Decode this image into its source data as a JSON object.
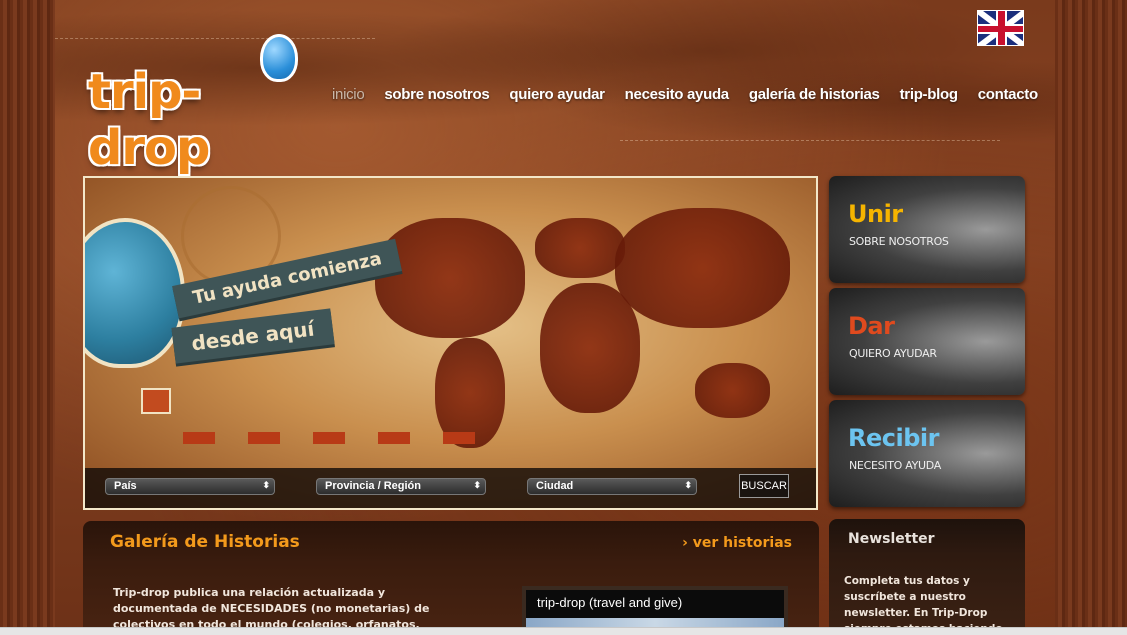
{
  "logo": {
    "text": "trip-drop"
  },
  "language": {
    "flag_icon": "uk-flag-icon"
  },
  "nav": [
    {
      "label": "inicio",
      "active": true
    },
    {
      "label": "sobre nosotros"
    },
    {
      "label": "quiero ayudar"
    },
    {
      "label": "necesito ayuda"
    },
    {
      "label": "galería de historias"
    },
    {
      "label": "trip-blog"
    },
    {
      "label": "contacto"
    }
  ],
  "hero": {
    "banner_line1": "Tu ayuda comienza",
    "banner_line2": "desde aquí",
    "search": {
      "pais": "País",
      "provincia": "Provincia / Región",
      "ciudad": "Ciudad",
      "button": "BUSCAR"
    }
  },
  "cards": [
    {
      "title": "Unir",
      "subtitle": "SOBRE NOSOTROS",
      "color": "#f5b400"
    },
    {
      "title": "Dar",
      "subtitle": "QUIERO AYUDAR",
      "color": "#e04a1e"
    },
    {
      "title": "Recibir",
      "subtitle": "NECESITO AYUDA",
      "color": "#6cc4f0"
    }
  ],
  "gallery": {
    "title": "Galería de Historias",
    "more": "› ver historias",
    "text": "Trip-drop publica una relación actualizada y documentada de NECESIDADES (no monetarias) de colectivos en todo el mundo (colegios, orfanatos, comedores, residencias, ONGs)",
    "video_title": "trip-drop (travel and give)"
  },
  "newsletter": {
    "title": "Newsletter",
    "text": "Completa tus datos y suscríbete a nuestro newsletter. En Trip-Drop siempre estamos haciendo algo nuevo. Entérate"
  }
}
